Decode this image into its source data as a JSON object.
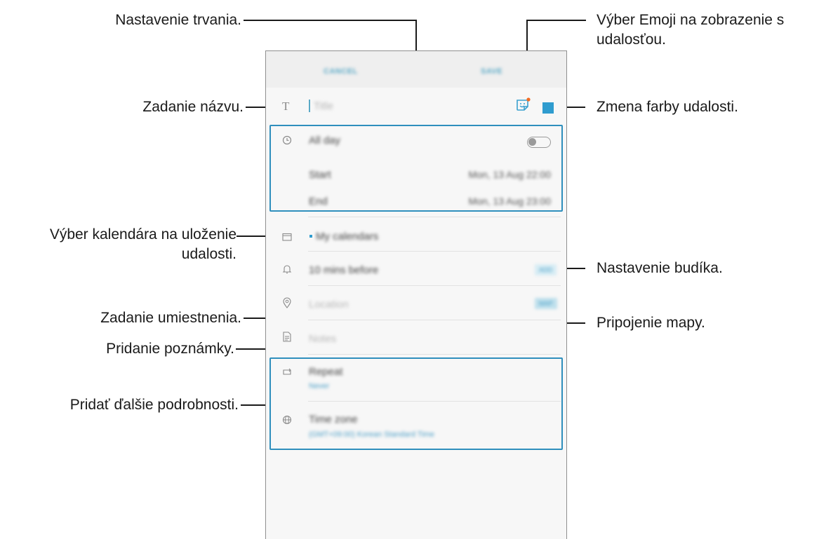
{
  "callouts": {
    "duration": "Nastavenie trvania.",
    "title": "Zadanie názvu.",
    "calendar_line1": "Výber kalendára na uloženie",
    "calendar_line2": "udalosti.",
    "location": "Zadanie umiestnenia.",
    "note": "Pridanie poznámky.",
    "details": "Pridať ďalšie podrobnosti.",
    "emoji_line1": "Výber Emoji na zobrazenie s",
    "emoji_line2": "udalosťou.",
    "color": "Zmena farby udalosti.",
    "alarm": "Nastavenie budíka.",
    "map": "Pripojenie mapy."
  },
  "header": {
    "cancel": "CANCEL",
    "save": "SAVE"
  },
  "form": {
    "title_placeholder": "Title",
    "all_day": "All day",
    "start_label": "Start",
    "start_value": "Mon, 13 Aug  22:00",
    "end_label": "End",
    "end_value": "Mon, 13 Aug  23:00",
    "calendar": "My calendars",
    "reminder": "10 mins before",
    "reminder_action": "ADD",
    "location": "Location",
    "map_action": "MAP",
    "notes": "Notes",
    "repeat": "Repeat",
    "repeat_value": "Never",
    "timezone": "Time zone",
    "timezone_value": "(GMT+09:00) Korean Standard Time"
  },
  "colors": {
    "accent": "#2f8fbd",
    "event_color": "#2f9ccf",
    "emoji_badge": "#f26a21"
  },
  "icons": [
    "text-icon",
    "clock-icon",
    "calendar-icon",
    "bell-icon",
    "location-pin-icon",
    "note-icon",
    "repeat-icon",
    "globe-icon",
    "sticker-emoji-icon"
  ]
}
